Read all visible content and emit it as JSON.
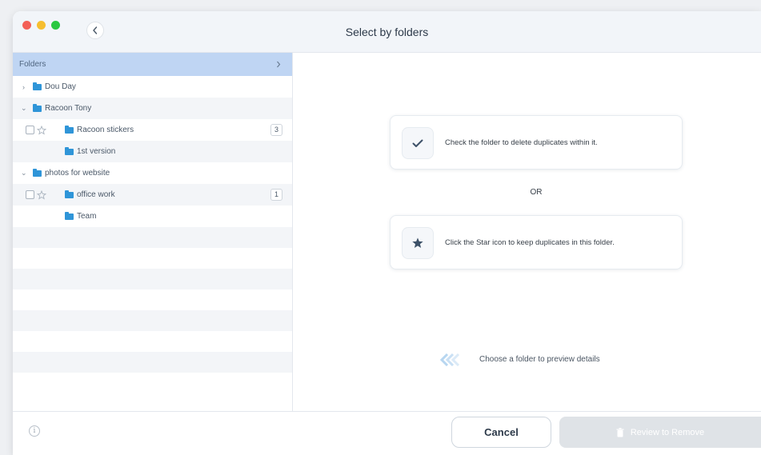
{
  "window": {
    "title": "Select by folders"
  },
  "sidebar": {
    "header": "Folders",
    "rows": [
      {
        "label": "Dou Day"
      },
      {
        "label": "Racoon Tony"
      },
      {
        "label": "Racoon stickers",
        "count": "3"
      },
      {
        "label": "1st version"
      },
      {
        "label": "photos for website"
      },
      {
        "label": "office work",
        "count": "1"
      },
      {
        "label": "Team"
      }
    ]
  },
  "main": {
    "check_hint": "Check the folder to delete duplicates within it.",
    "or_label": "OR",
    "star_hint": "Click the Star icon to keep duplicates in this folder.",
    "preview_hint": "Choose a folder to preview details"
  },
  "footer": {
    "info_icon": "i",
    "cancel_label": "Cancel",
    "review_label": "Review to Remove"
  },
  "colors": {
    "sidebar_header_bg": "#bfd5f3",
    "folder_icon": "#2f95d8",
    "button_disabled_bg": "#dfe3e7"
  }
}
